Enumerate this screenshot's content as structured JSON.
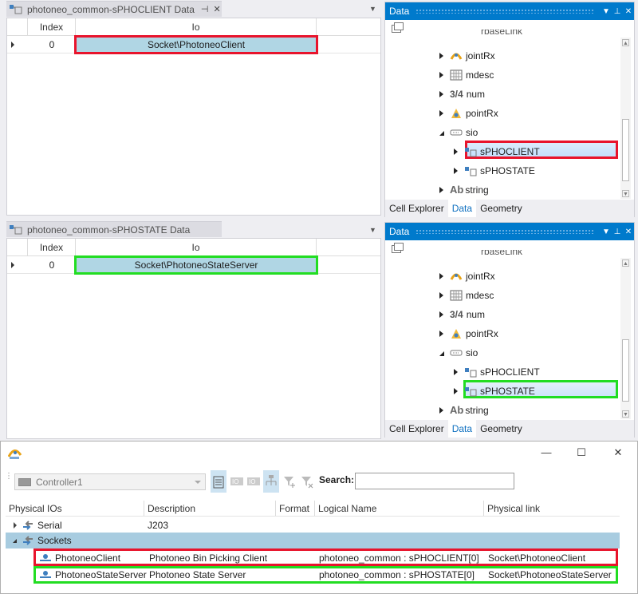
{
  "top_grid": {
    "tab_title": "photoneo_common-sPHOCLIENT Data",
    "columns": [
      "Index",
      "Io"
    ],
    "rows": [
      {
        "index": "0",
        "io": "Socket\\PhotoneoClient"
      }
    ]
  },
  "bottom_grid": {
    "tab_title": "photoneo_common-sPHOSTATE Data",
    "columns": [
      "Index",
      "Io"
    ],
    "rows": [
      {
        "index": "0",
        "io": "Socket\\PhotoneoStateServer"
      }
    ]
  },
  "data_panel_top": {
    "title": "Data",
    "partial_item": "rbaseLink",
    "items": [
      "jointRx",
      "mdesc",
      "num",
      "pointRx",
      "sio",
      "sPHOCLIENT",
      "sPHOSTATE",
      "string"
    ],
    "num_glyph": "3/4",
    "string_glyph": "Ab",
    "selected": "sPHOCLIENT",
    "tabs": [
      "Cell Explorer",
      "Data",
      "Geometry"
    ],
    "active_tab": "Data"
  },
  "data_panel_bottom": {
    "title": "Data",
    "partial_item": "rbaseLink",
    "items": [
      "jointRx",
      "mdesc",
      "num",
      "pointRx",
      "sio",
      "sPHOCLIENT",
      "sPHOSTATE",
      "string"
    ],
    "num_glyph": "3/4",
    "string_glyph": "Ab",
    "selected": "sPHOSTATE",
    "tabs": [
      "Cell Explorer",
      "Data",
      "Geometry"
    ],
    "active_tab": "Data"
  },
  "io_window": {
    "controls": {
      "minimize": "—",
      "maximize": "☐",
      "close": "✕"
    },
    "controller": "Controller1",
    "search_label": "Search:",
    "search_value": "",
    "columns": [
      "Physical IOs",
      "Description",
      "Format",
      "Logical Name",
      "Physical link"
    ],
    "groups": [
      {
        "name": "Serial",
        "description": "J203",
        "expanded": false
      },
      {
        "name": "Sockets",
        "description": "",
        "expanded": true
      }
    ],
    "rows": [
      {
        "name": "PhotoneoClient",
        "description": "Photoneo Bin Picking Client",
        "format": "",
        "logical_name": "photoneo_common : sPHOCLIENT[0]",
        "physical_link": "Socket\\PhotoneoClient"
      },
      {
        "name": "PhotoneoStateServer",
        "description": "Photoneo State Server",
        "format": "",
        "logical_name": "photoneo_common : sPHOSTATE[0]",
        "physical_link": "Socket\\PhotoneoStateServer"
      }
    ]
  },
  "colors": {
    "accent": "#007acc",
    "highlight_red": "#e8142c",
    "highlight_green": "#22dd22",
    "cell_blue": "#b0d6e4",
    "selected_row": "#a8cce0"
  }
}
